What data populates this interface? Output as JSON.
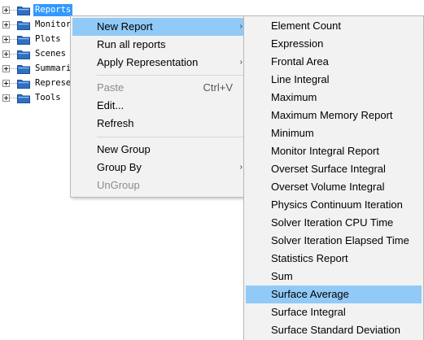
{
  "tree": [
    {
      "label": "Reports",
      "selected": true
    },
    {
      "label": "Monitor"
    },
    {
      "label": "Plots"
    },
    {
      "label": "Scenes"
    },
    {
      "label": "Summari"
    },
    {
      "label": "Represe"
    },
    {
      "label": "Tools"
    }
  ],
  "context_menu": {
    "new_report": "New Report",
    "run_all": "Run all reports",
    "apply_representation": "Apply Representation",
    "paste": "Paste",
    "paste_shortcut": "Ctrl+V",
    "edit": "Edit...",
    "refresh": "Refresh",
    "new_group": "New Group",
    "group_by": "Group By",
    "ungroup": "UnGroup",
    "arrow": "›"
  },
  "submenu": {
    "items": [
      "Element Count",
      "Expression",
      "Frontal Area",
      "Line Integral",
      "Maximum",
      "Maximum Memory Report",
      "Minimum",
      "Monitor Integral Report",
      "Overset Surface Integral",
      "Overset Volume Integral",
      "Physics Continuum Iteration",
      "Solver Iteration CPU Time",
      "Solver Iteration Elapsed Time",
      "Statistics Report",
      "Sum",
      "Surface Average",
      "Surface Integral",
      "Surface Standard Deviation"
    ],
    "highlighted": "Surface Average"
  },
  "colors": {
    "selection": "#3399ff",
    "menu_highlight": "#91c9f7",
    "folder": "#2f6fc4"
  }
}
